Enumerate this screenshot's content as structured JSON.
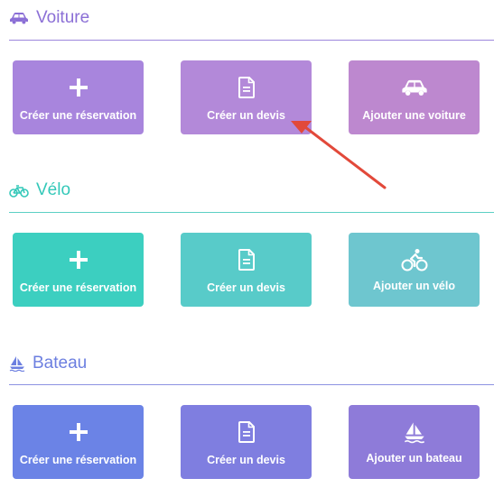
{
  "sections": {
    "voiture": {
      "title": "Voiture",
      "title_icon": "car-icon",
      "color": "#8b6fd6",
      "buttons": [
        {
          "label": "Créer une réservation",
          "icon": "plus-icon",
          "color": "#a885dd"
        },
        {
          "label": "Créer un devis",
          "icon": "document-icon",
          "color": "#b389d9"
        },
        {
          "label": "Ajouter une voiture",
          "icon": "car-icon",
          "color": "#bd88cf"
        }
      ]
    },
    "velo": {
      "title": "Vélo",
      "title_icon": "bicycle-icon",
      "color": "#34c8b9",
      "buttons": [
        {
          "label": "Créer une réservation",
          "icon": "plus-icon",
          "color": "#3ccfc0"
        },
        {
          "label": "Créer un devis",
          "icon": "document-icon",
          "color": "#58cbc9"
        },
        {
          "label": "Ajouter un vélo",
          "icon": "cyclist-icon",
          "color": "#6ec6cf"
        }
      ]
    },
    "bateau": {
      "title": "Bateau",
      "title_icon": "sailboat-icon",
      "color": "#6c7fe0",
      "buttons": [
        {
          "label": "Créer une réservation",
          "icon": "plus-icon",
          "color": "#6b83e6"
        },
        {
          "label": "Créer un devis",
          "icon": "document-icon",
          "color": "#7f7ee0"
        },
        {
          "label": "Ajouter un bateau",
          "icon": "sailboat-icon",
          "color": "#8e7bd9"
        }
      ]
    }
  },
  "annotation": {
    "type": "red-arrow",
    "points_to": "Créer un devis",
    "color": "#e2493a"
  }
}
